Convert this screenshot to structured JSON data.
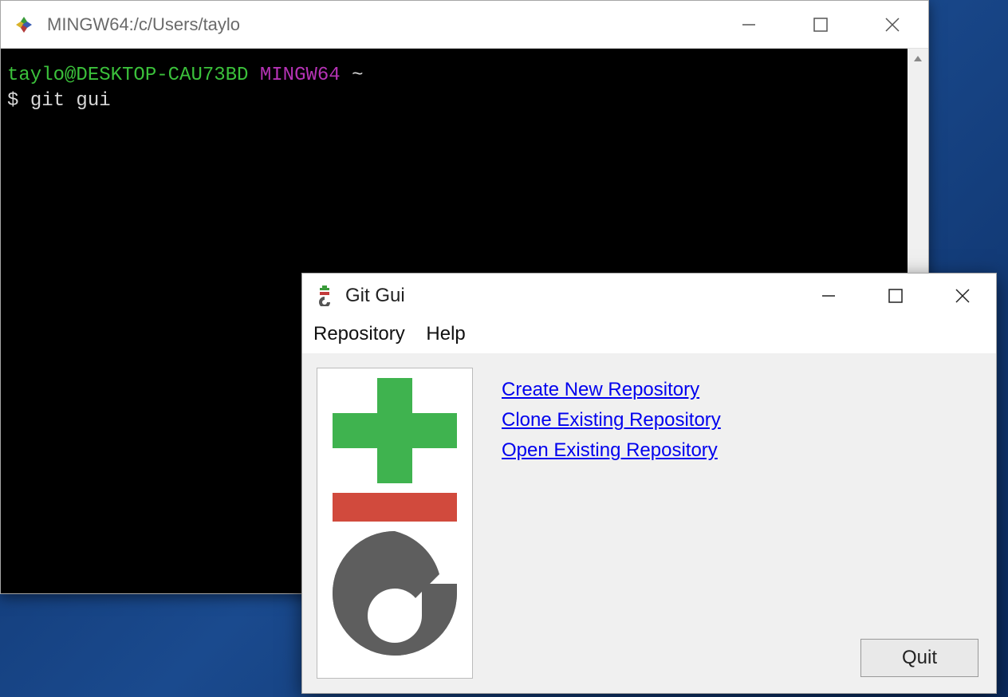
{
  "terminal": {
    "title": "MINGW64:/c/Users/taylo",
    "prompt_user": "taylo@DESKTOP-CAU73BD",
    "prompt_env": "MINGW64",
    "prompt_path": "~",
    "prompt_symbol": "$",
    "command": "git gui"
  },
  "gitgui": {
    "title": "Git Gui",
    "menu": {
      "repository": "Repository",
      "help": "Help"
    },
    "links": {
      "create": "Create New Repository",
      "clone": "Clone Existing Repository",
      "open": "Open Existing Repository"
    },
    "quit_label": "Quit"
  }
}
